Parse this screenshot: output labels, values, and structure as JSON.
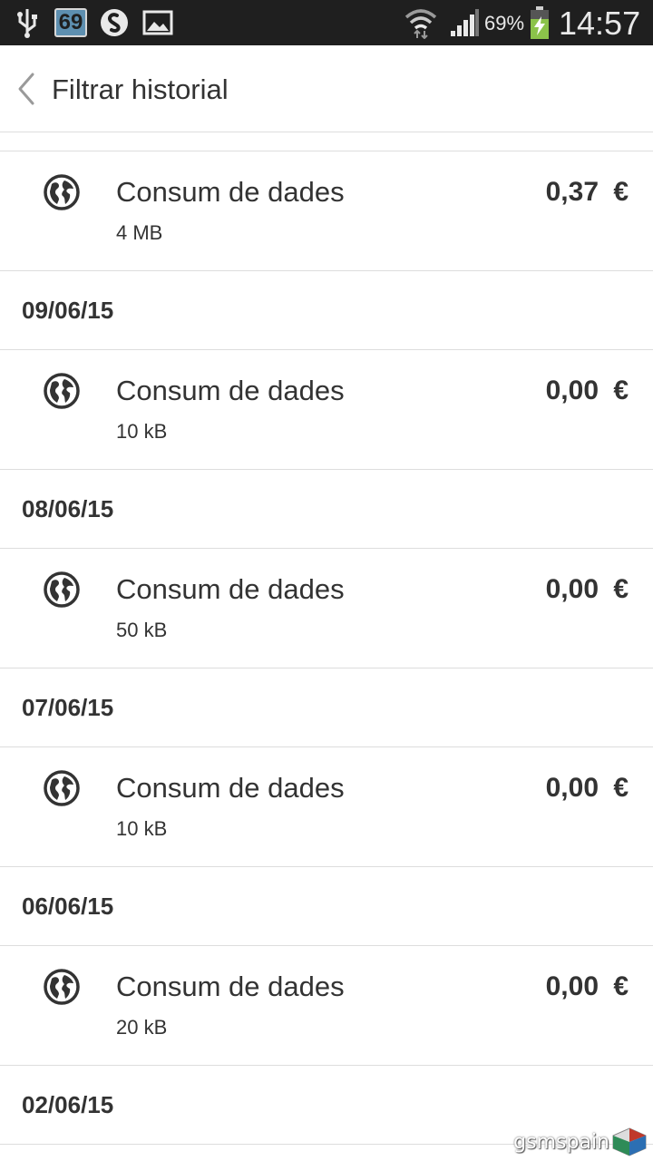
{
  "status_bar": {
    "notification_badge": "69",
    "battery_percent": "69%",
    "clock": "14:57",
    "icons": [
      "usb-icon",
      "notification-69-icon",
      "shazam-icon",
      "gallery-icon",
      "wifi-icon",
      "signal-icon",
      "battery-charging-icon"
    ]
  },
  "app_bar": {
    "title": "Filtrar historial",
    "back_icon": "chevron-left-icon"
  },
  "first_group": {
    "title": "Consum de dades",
    "sub": "4 MB",
    "amount": "0,37",
    "currency": "€"
  },
  "groups": [
    {
      "date": "09/06/15",
      "title": "Consum de dades",
      "sub": "10 kB",
      "amount": "0,00",
      "currency": "€"
    },
    {
      "date": "08/06/15",
      "title": "Consum de dades",
      "sub": "50 kB",
      "amount": "0,00",
      "currency": "€"
    },
    {
      "date": "07/06/15",
      "title": "Consum de dades",
      "sub": "10 kB",
      "amount": "0,00",
      "currency": "€"
    },
    {
      "date": "06/06/15",
      "title": "Consum de dades",
      "sub": "20 kB",
      "amount": "0,00",
      "currency": "€"
    }
  ],
  "last_date": "02/06/15",
  "watermark": "gsmspain",
  "colors": {
    "status_bar_bg": "#1f1f1f",
    "text": "#333333",
    "divider": "#dddddd",
    "battery_green": "#8bc34a"
  }
}
